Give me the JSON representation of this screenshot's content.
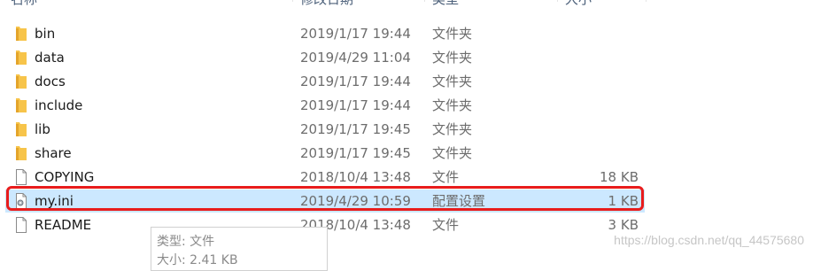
{
  "header": {
    "name": "名称",
    "date": "修改日期",
    "type": "类型",
    "size": "大小"
  },
  "files": [
    {
      "name": "bin",
      "date": "2019/1/17 19:44",
      "type": "文件夹",
      "size": "",
      "icon": "folder-icon"
    },
    {
      "name": "data",
      "date": "2019/4/29 11:04",
      "type": "文件夹",
      "size": "",
      "icon": "folder-icon"
    },
    {
      "name": "docs",
      "date": "2019/1/17 19:44",
      "type": "文件夹",
      "size": "",
      "icon": "folder-icon"
    },
    {
      "name": "include",
      "date": "2019/1/17 19:44",
      "type": "文件夹",
      "size": "",
      "icon": "folder-icon"
    },
    {
      "name": "lib",
      "date": "2019/1/17 19:45",
      "type": "文件夹",
      "size": "",
      "icon": "folder-icon"
    },
    {
      "name": "share",
      "date": "2019/1/17 19:45",
      "type": "文件夹",
      "size": "",
      "icon": "folder-icon"
    },
    {
      "name": "COPYING",
      "date": "2018/10/4 13:48",
      "type": "文件",
      "size": "18 KB",
      "icon": "file-icon"
    },
    {
      "name": "my.ini",
      "date": "2019/4/29 10:59",
      "type": "配置设置",
      "size": "1 KB",
      "icon": "settings-file-icon",
      "selected": true
    },
    {
      "name": "README",
      "date": "2018/10/4 13:48",
      "type": "文件",
      "size": "3 KB",
      "icon": "file-icon"
    }
  ],
  "tooltip": {
    "type_line": "类型: 文件",
    "size_line": "大小: 2.41 KB"
  },
  "watermark": "https://blog.csdn.net/qq_44575680",
  "colors": {
    "selected_bg": "#cce8ff",
    "highlight_border": "#e81c1c",
    "folder": "#f7c44a"
  }
}
